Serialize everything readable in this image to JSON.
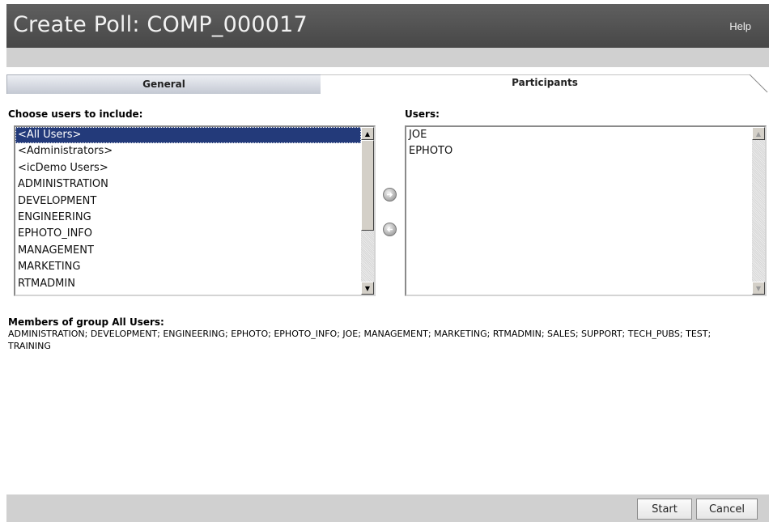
{
  "window": {
    "title": "Create Poll: COMP_000017",
    "help_label": "Help"
  },
  "tabs": [
    {
      "label": "General",
      "active": false
    },
    {
      "label": "Participants",
      "active": true
    }
  ],
  "choose": {
    "label": "Choose users to include:",
    "items": [
      "<All Users>",
      "<Administrators>",
      "<icDemo Users>",
      "ADMINISTRATION",
      "DEVELOPMENT",
      "ENGINEERING",
      "EPHOTO_INFO",
      "MANAGEMENT",
      "MARKETING",
      "RTMADMIN"
    ],
    "selected": "<All Users>"
  },
  "users": {
    "label": "Users:",
    "items": [
      "JOE",
      "EPHOTO"
    ]
  },
  "transfer": {
    "add_icon": "arrow-right-icon",
    "remove_icon": "arrow-left-icon"
  },
  "members": {
    "title": "Members of group All Users:",
    "text": "ADMINISTRATION; DEVELOPMENT; ENGINEERING; EPHOTO; EPHOTO_INFO; JOE; MANAGEMENT; MARKETING; RTMADMIN; SALES; SUPPORT; TECH_PUBS; TEST; TRAINING"
  },
  "footer": {
    "start_label": "Start",
    "cancel_label": "Cancel"
  },
  "colors": {
    "titlebar": "#4f4f4f",
    "selection": "#233a7a"
  }
}
